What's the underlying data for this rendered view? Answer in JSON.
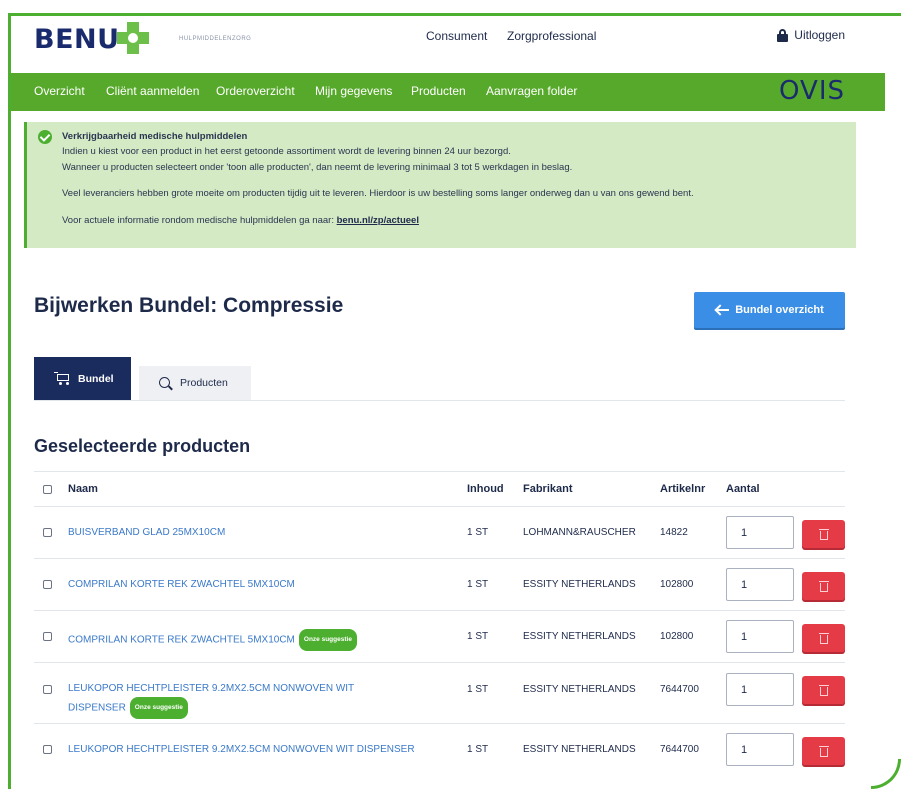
{
  "header": {
    "logo_text": "BENU",
    "logo_sub": "HULPMIDDELENZORG",
    "links": [
      "Consument",
      "Zorgprofessional"
    ],
    "logout_label": "Uitloggen"
  },
  "nav": {
    "items": [
      "Overzicht",
      "Cliënt aanmelden",
      "Orderoverzicht",
      "Mijn gegevens",
      "Producten",
      "Aanvragen folder"
    ],
    "partner_logo": "OVIS"
  },
  "notice": {
    "title": "Verkrijgbaarheid medische hulpmiddelen",
    "line1": "Indien u kiest voor een product in het eerst getoonde assortiment wordt de levering binnen 24 uur bezorgd.",
    "line2": "Wanneer u producten selecteert onder 'toon alle producten', dan neemt de levering minimaal 3 tot 5 werkdagen in beslag.",
    "line3": "Veel leveranciers hebben grote moeite om producten tijdig uit te leveren. Hierdoor is uw bestelling soms langer onderweg dan u van ons gewend bent.",
    "line4_prefix": "Voor actuele informatie rondom medische hulpmiddelen ga naar: ",
    "line4_link": "benu.nl/zp/actueel"
  },
  "page": {
    "title": "Bijwerken Bundel: Compressie",
    "back_button": "Bundel overzicht",
    "tabs": [
      "Bundel",
      "Producten"
    ],
    "section_title": "Geselecteerde producten"
  },
  "table": {
    "headers": {
      "name": "Naam",
      "content": "Inhoud",
      "manufacturer": "Fabrikant",
      "article": "Artikelnr",
      "qty": "Aantal"
    },
    "badge_label": "Onze suggestie",
    "rows": [
      {
        "name": "BUISVERBAND GLAD 25MX10CM",
        "name2": "",
        "badge": "",
        "content": "1 ST",
        "manufacturer": "LOHMANN&RAUSCHER",
        "article": "14822",
        "qty": "1"
      },
      {
        "name": "COMPRILAN KORTE REK ZWACHTEL 5MX10CM",
        "name2": "",
        "badge": "",
        "content": "1 ST",
        "manufacturer": "ESSITY NETHERLANDS",
        "article": "102800",
        "qty": "1"
      },
      {
        "name": "COMPRILAN KORTE REK ZWACHTEL 5MX10CM",
        "name2": "",
        "badge": "Onze suggestie",
        "content": "1 ST",
        "manufacturer": "ESSITY NETHERLANDS",
        "article": "102800",
        "qty": "1"
      },
      {
        "name": "LEUKOPOR HECHTPLEISTER 9.2MX2.5CM NONWOVEN WIT",
        "name2": "DISPENSER",
        "badge": "Onze suggestie",
        "content": "1 ST",
        "manufacturer": "ESSITY NETHERLANDS",
        "article": "7644700",
        "qty": "1"
      },
      {
        "name": "LEUKOPOR HECHTPLEISTER 9.2MX2.5CM NONWOVEN WIT DISPENSER",
        "name2": "",
        "badge": "",
        "content": "1 ST",
        "manufacturer": "ESSITY NETHERLANDS",
        "article": "7644700",
        "qty": "1"
      }
    ]
  }
}
